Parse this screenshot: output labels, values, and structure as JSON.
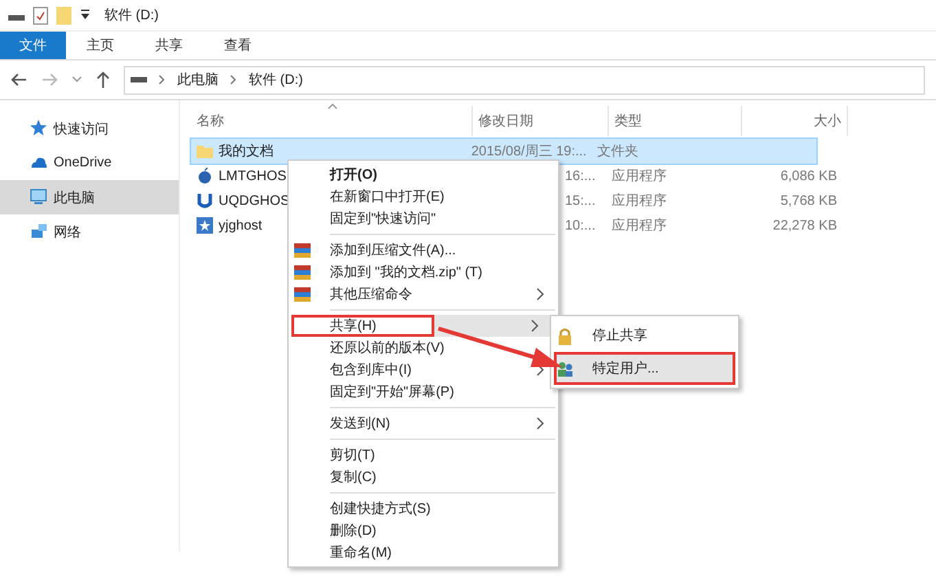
{
  "window": {
    "title": "软件 (D:)"
  },
  "ribbon_tabs": [
    {
      "label": "文件",
      "selected": true
    },
    {
      "label": "主页",
      "selected": false
    },
    {
      "label": "共享",
      "selected": false
    },
    {
      "label": "查看",
      "selected": false
    }
  ],
  "address": {
    "crumbs": [
      "此电脑",
      "软件 (D:)"
    ]
  },
  "sidebar": {
    "items": [
      {
        "label": "快速访问",
        "kind": "star",
        "selected": false
      },
      {
        "label": "OneDrive",
        "kind": "cloud",
        "selected": false
      },
      {
        "label": "此电脑",
        "kind": "pc",
        "selected": true
      },
      {
        "label": "网络",
        "kind": "network",
        "selected": false
      }
    ]
  },
  "table": {
    "columns": [
      "名称",
      "修改日期",
      "类型",
      "大小"
    ],
    "rows": [
      {
        "name": "我的文档",
        "kind": "folder",
        "date": "2015/08/周三 19:...",
        "type": "文件夹",
        "size": "",
        "selected": true
      },
      {
        "name": "LMTGHOS",
        "kind": "app-blue",
        "date": "16:...",
        "type": "应用程序",
        "size": "6,086 KB",
        "selected": false
      },
      {
        "name": "UQDGHOS",
        "kind": "app-u",
        "date": "15:...",
        "type": "应用程序",
        "size": "5,768 KB",
        "selected": false
      },
      {
        "name": "yjghost",
        "kind": "app-star",
        "date": "10:...",
        "type": "应用程序",
        "size": "22,278 KB",
        "selected": false
      }
    ]
  },
  "context_menu": {
    "items": [
      {
        "label": "打开(O)",
        "kind": "bold"
      },
      {
        "label": "在新窗口中打开(E)",
        "kind": "plain"
      },
      {
        "label": "固定到\"快速访问\"",
        "kind": "plain"
      },
      {
        "kind": "separator"
      },
      {
        "label": "添加到压缩文件(A)...",
        "kind": "archive"
      },
      {
        "label": "添加到 \"我的文档.zip\" (T)",
        "kind": "archive"
      },
      {
        "label": "其他压缩命令",
        "kind": "archive",
        "submenu": true
      },
      {
        "kind": "separator"
      },
      {
        "label": "共享(H)",
        "kind": "plain",
        "submenu": true,
        "selected": true,
        "annotated": true
      },
      {
        "label": "还原以前的版本(V)",
        "kind": "plain"
      },
      {
        "label": "包含到库中(I)",
        "kind": "plain",
        "submenu": true
      },
      {
        "label": "固定到\"开始\"屏幕(P)",
        "kind": "plain"
      },
      {
        "kind": "separator"
      },
      {
        "label": "发送到(N)",
        "kind": "plain",
        "submenu": true
      },
      {
        "kind": "separator"
      },
      {
        "label": "剪切(T)",
        "kind": "plain"
      },
      {
        "label": "复制(C)",
        "kind": "plain"
      },
      {
        "kind": "separator"
      },
      {
        "label": "创建快捷方式(S)",
        "kind": "plain"
      },
      {
        "label": "删除(D)",
        "kind": "plain"
      },
      {
        "label": "重命名(M)",
        "kind": "plain"
      }
    ]
  },
  "share_submenu": {
    "items": [
      {
        "label": "停止共享",
        "kind": "lock",
        "selected": false,
        "annotated": false
      },
      {
        "label": "特定用户...",
        "kind": "users",
        "selected": true,
        "annotated": true
      }
    ]
  }
}
